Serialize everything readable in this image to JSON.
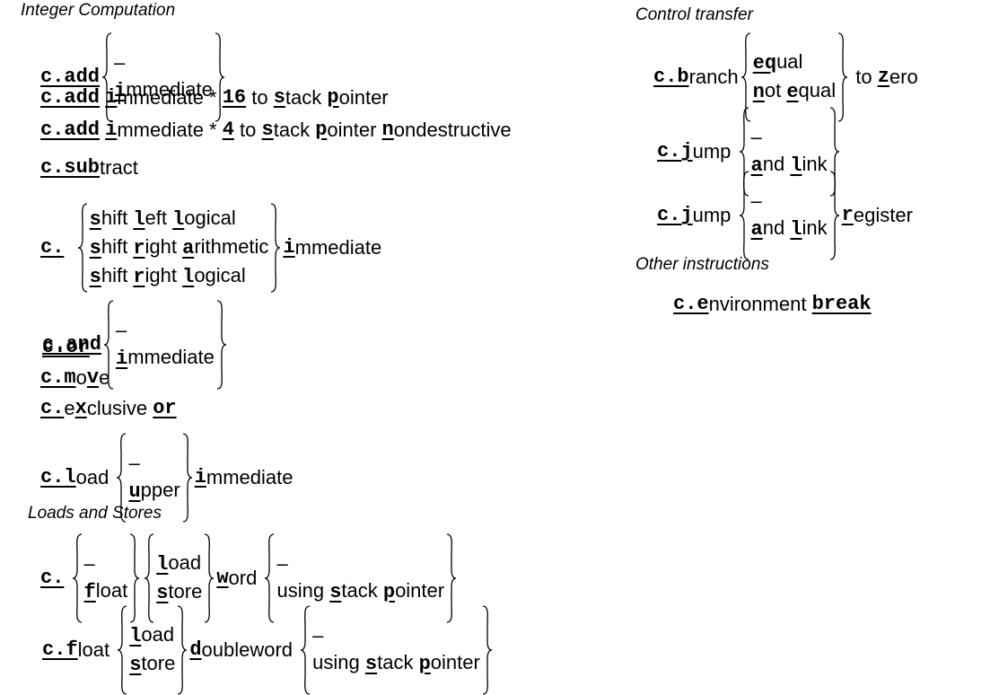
{
  "headers": {
    "integer": "Integer Computation",
    "loads": "Loads and Stores",
    "control": "Control transfer",
    "other": "Other instructions"
  },
  "rows": [
    {
      "id": "c-add",
      "parts": [
        {
          "u": "c.add",
          "mono": true
        },
        {
          "b": [
            "–",
            [
              {
                "u": "i"
              },
              "mmediate"
            ]
          ]
        }
      ]
    },
    {
      "id": "c-addi16sp",
      "parts": [
        {
          "u": "c.add",
          "mono": true
        },
        {
          "s": " "
        },
        {
          "u": "i",
          "mono": true
        },
        "mmediate * ",
        {
          "u": "16",
          "mono": true
        },
        " to ",
        {
          "u": "s"
        },
        "tack ",
        {
          "u": "p"
        },
        "ointer"
      ]
    },
    {
      "id": "c-addi4spn",
      "parts": [
        {
          "u": "c.add",
          "mono": true
        },
        {
          "s": " "
        },
        {
          "u": "i",
          "mono": true
        },
        "mmediate * ",
        {
          "u": "4",
          "mono": true
        },
        " to ",
        {
          "u": "s"
        },
        "tack ",
        {
          "u": "p"
        },
        "ointer ",
        {
          "u": "n"
        },
        "ondestructive"
      ]
    },
    {
      "id": "c-sub",
      "parts": [
        {
          "u": "c.sub",
          "mono": true
        },
        "tract"
      ]
    },
    {
      "id": "c-shifts",
      "parts": [
        {
          "u": "c.",
          "mono": true
        },
        {
          "s": "  "
        },
        {
          "b": [
            [
              {
                "u": "s"
              },
              "hift ",
              {
                "u": "l",
                "mono": true
              },
              "eft ",
              {
                "u": "l",
                "mono": true
              },
              "ogical"
            ],
            [
              {
                "u": "s"
              },
              "hift ",
              {
                "u": "r"
              },
              "ight ",
              {
                "u": "a"
              },
              "rithmetic"
            ],
            [
              {
                "u": "s"
              },
              "hift ",
              {
                "u": "r"
              },
              "ight ",
              {
                "u": "l",
                "mono": true
              },
              "ogical"
            ]
          ]
        },
        {
          "u": "i",
          "mono": true
        },
        "mmediate"
      ]
    },
    {
      "id": "c-and",
      "parts": [
        {
          "u": "c.and",
          "mono": true
        },
        {
          "b": [
            "–",
            [
              {
                "u": "i",
                "mono": true
              },
              "mmediate"
            ]
          ]
        }
      ]
    },
    {
      "id": "c-or",
      "parts": [
        {
          "u": "c.or",
          "mono": true
        }
      ]
    },
    {
      "id": "c-mv",
      "parts": [
        {
          "u": "c.m",
          "mono": true
        },
        "o",
        {
          "u": "v"
        },
        "e"
      ]
    },
    {
      "id": "c-xor",
      "parts": [
        {
          "u": "c.",
          "mono": true
        },
        "e",
        {
          "u": "x"
        },
        "clusive ",
        {
          "u": "or",
          "mono": true
        }
      ]
    },
    {
      "id": "c-lui",
      "parts": [
        {
          "u": "c.l",
          "mono": true
        },
        "oad ",
        {
          "b": [
            "–",
            [
              {
                "u": "u"
              },
              "pper"
            ]
          ]
        },
        {
          "u": "i",
          "mono": true
        },
        "mmediate"
      ]
    },
    {
      "id": "c-lw-sw",
      "parts": [
        {
          "u": "c.",
          "mono": true
        },
        {
          "s": " "
        },
        {
          "b": [
            "–",
            [
              {
                "u": "f",
                "mono": true
              },
              "loat"
            ]
          ]
        },
        {
          "b": [
            [
              {
                "u": "l",
                "mono": true
              },
              "oad"
            ],
            [
              {
                "u": "s"
              },
              "tore"
            ]
          ]
        },
        {
          "u": "w"
        },
        "ord ",
        {
          "b": [
            "–",
            [
              "using ",
              {
                "u": "s"
              },
              "tack ",
              {
                "u": "p"
              },
              "ointer"
            ]
          ]
        }
      ]
    },
    {
      "id": "c-fld-fsd",
      "parts": [
        {
          "u": "c.f",
          "mono": true
        },
        "loat ",
        {
          "b": [
            [
              {
                "u": "l",
                "mono": true
              },
              "oad"
            ],
            [
              {
                "u": "s"
              },
              "tore"
            ]
          ]
        },
        {
          "u": "d"
        },
        "oubleword ",
        {
          "b": [
            "–",
            [
              "using ",
              {
                "u": "s"
              },
              "tack ",
              {
                "u": "p"
              },
              "ointer"
            ]
          ]
        }
      ]
    },
    {
      "id": "c-branch",
      "parts": [
        {
          "u": "c.b",
          "mono": true
        },
        "ranch",
        {
          "b": [
            [
              {
                "u": "eq",
                "mono": true
              },
              "ual"
            ],
            [
              {
                "u": "n"
              },
              "ot ",
              {
                "u": "e"
              },
              "qual"
            ]
          ]
        },
        " to ",
        {
          "u": "z"
        },
        "ero"
      ]
    },
    {
      "id": "c-jump",
      "parts": [
        {
          "u": "c.j",
          "mono": true
        },
        "ump ",
        {
          "b": [
            "–",
            [
              {
                "u": "a"
              },
              "nd ",
              {
                "u": "l",
                "mono": true
              },
              "ink"
            ]
          ]
        }
      ]
    },
    {
      "id": "c-jump-reg",
      "parts": [
        {
          "u": "c.j",
          "mono": true
        },
        "ump ",
        {
          "b": [
            "–",
            [
              {
                "u": "a"
              },
              "nd ",
              {
                "u": "l",
                "mono": true
              },
              "ink"
            ]
          ]
        },
        {
          "u": "r"
        },
        "egister"
      ]
    },
    {
      "id": "c-ebreak",
      "parts": [
        {
          "u": "c.e",
          "mono": true
        },
        "nvironment ",
        {
          "u": "break",
          "mono": true
        }
      ]
    }
  ]
}
